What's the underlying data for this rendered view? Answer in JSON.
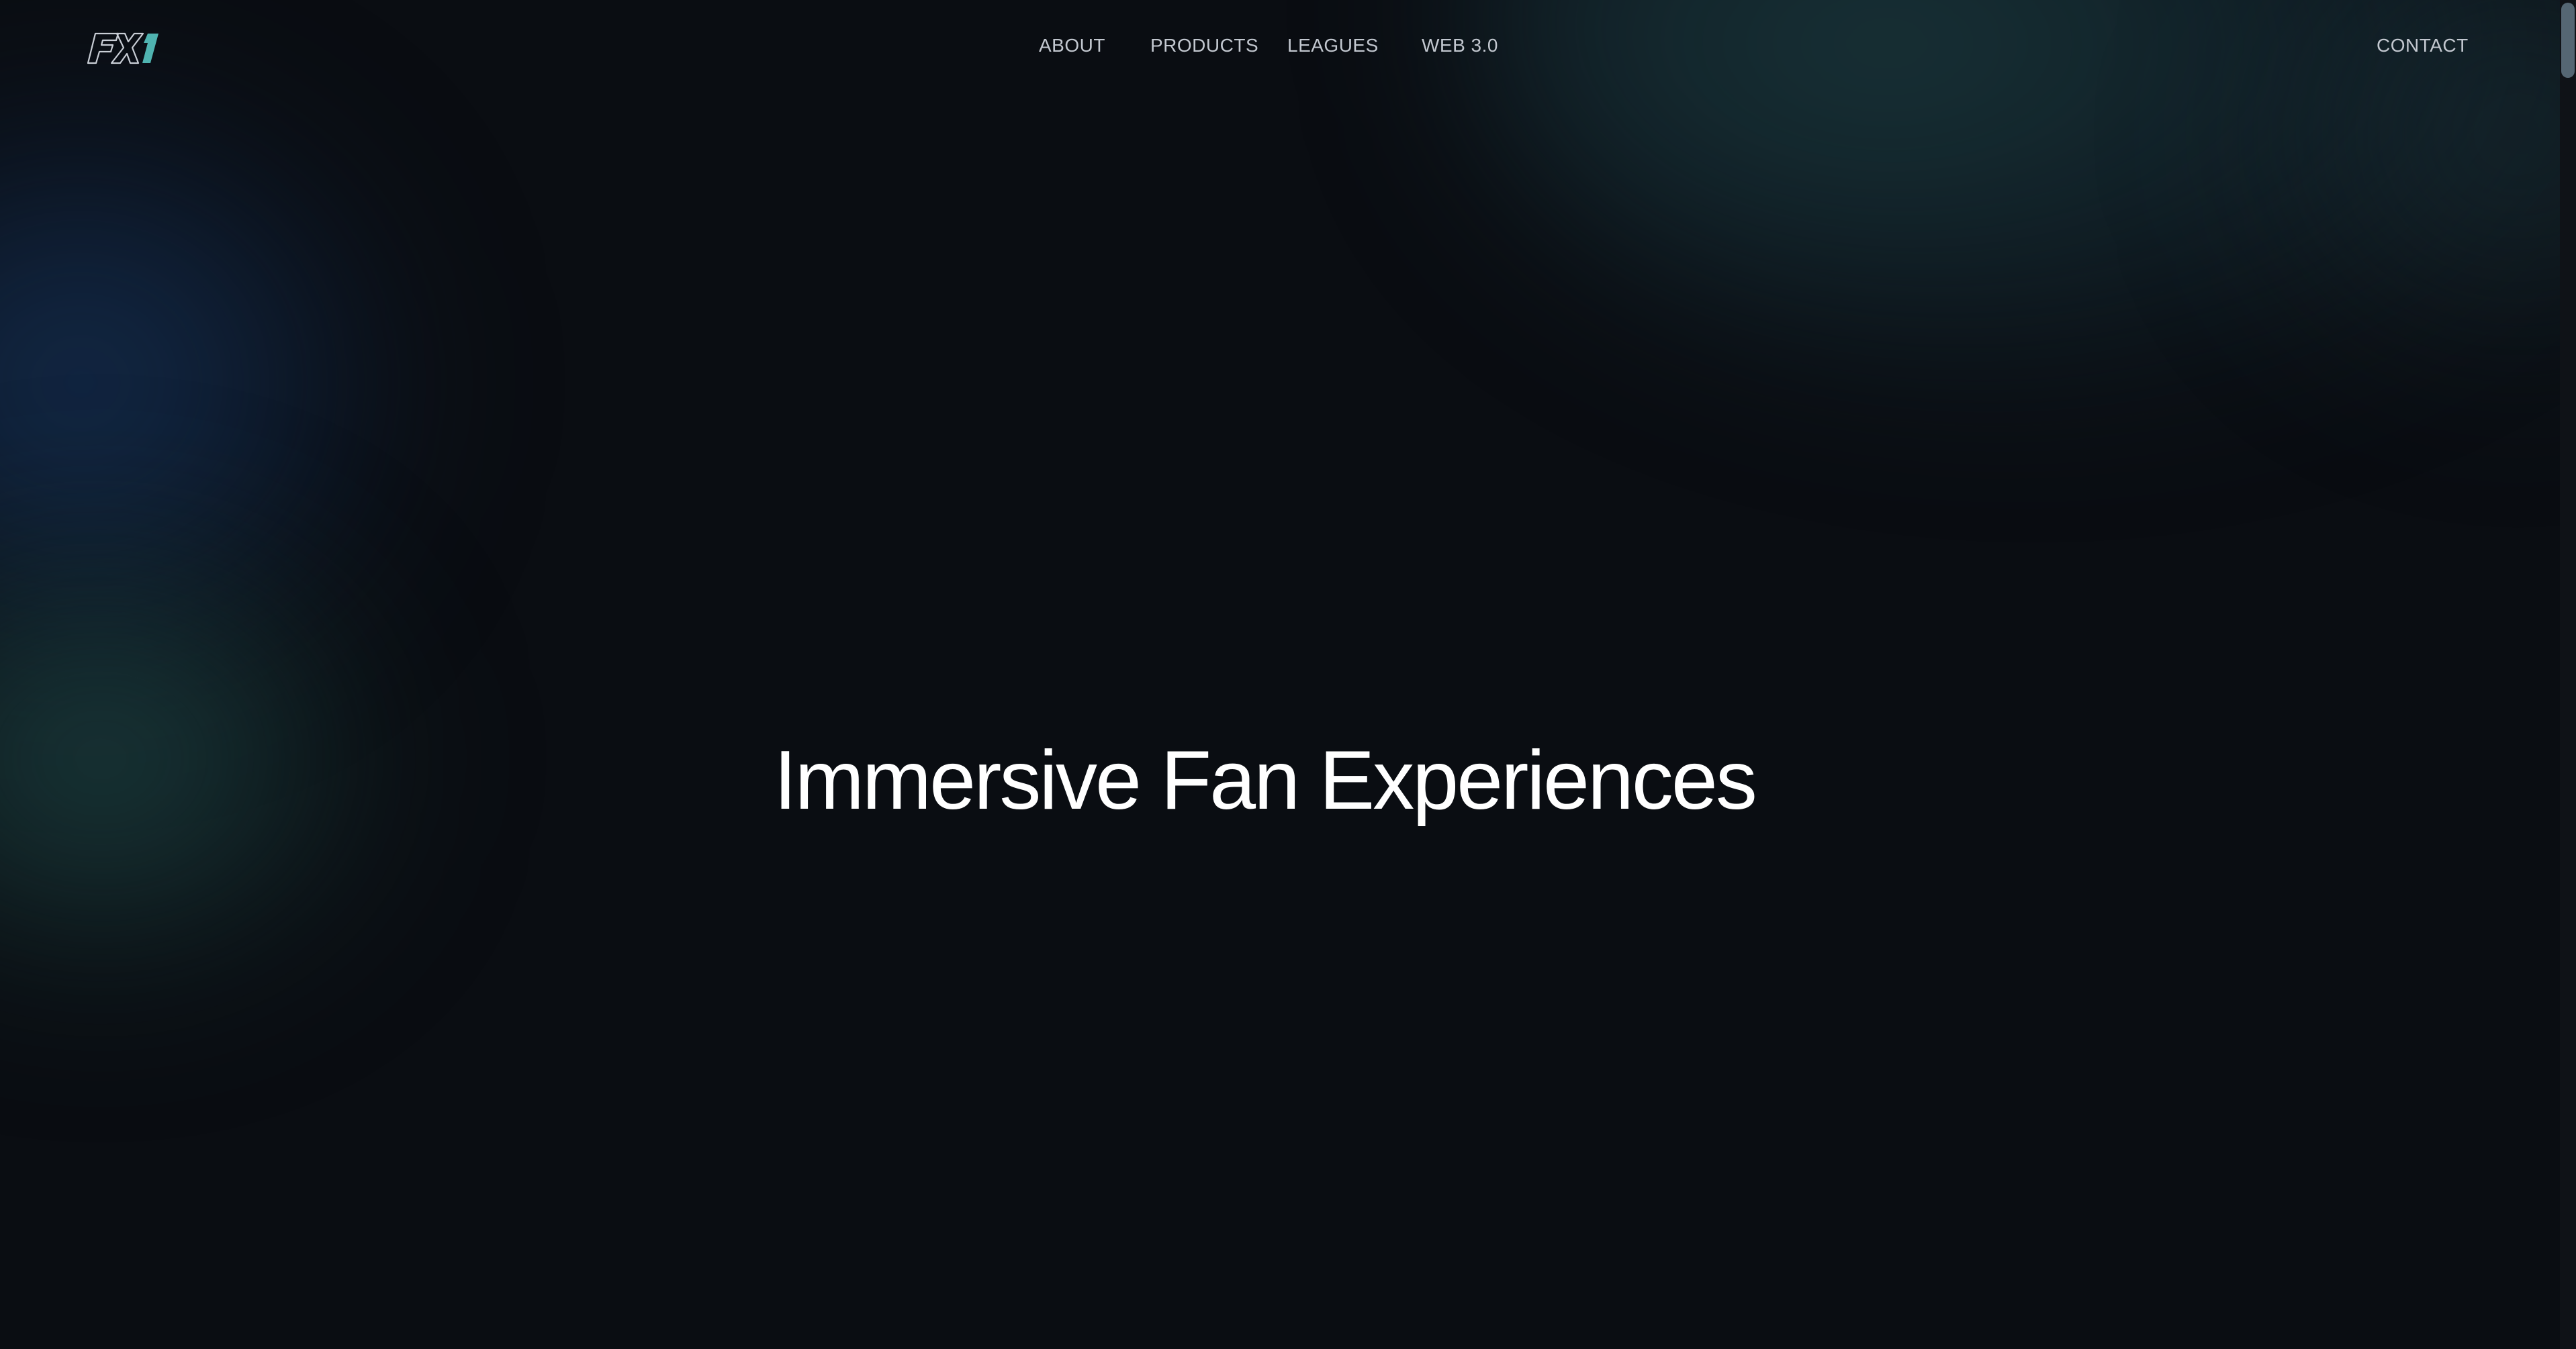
{
  "brand": {
    "logo_text": "FX1",
    "accent_color": "#4fb3b0"
  },
  "nav": {
    "items": [
      {
        "label": "ABOUT"
      },
      {
        "label": "PRODUCTS"
      },
      {
        "label": "LEAGUES"
      },
      {
        "label": "WEB 3.0"
      }
    ],
    "contact_label": "CONTACT"
  },
  "hero": {
    "title": "Immersive Fan Experiences"
  },
  "theme": {
    "background": "#0a0d12",
    "text": "#ffffff",
    "nav_text": "#c3c8d0"
  }
}
